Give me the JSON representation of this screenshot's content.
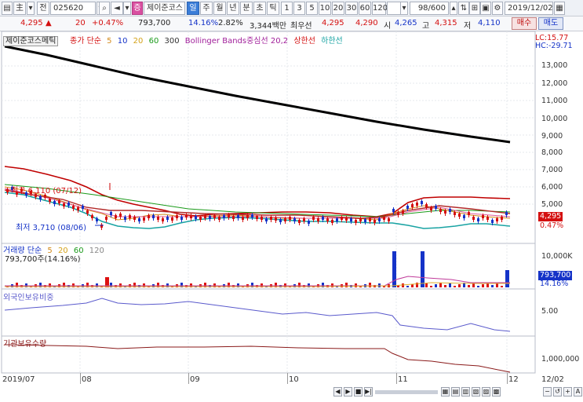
{
  "toolbar": {
    "code": "025620",
    "market_badge": "증",
    "stock_name": "제이준코스",
    "period_tabs": [
      "일",
      "주",
      "월",
      "년",
      "분",
      "초",
      "틱"
    ],
    "minute_options": [
      "1",
      "3",
      "5",
      "10",
      "20",
      "30",
      "60",
      "120"
    ],
    "count": "98/600",
    "date": "2019/12/02",
    "left_icons": [
      "chart-icon",
      "add-icon",
      "search-icon",
      "sound-icon"
    ],
    "right_icons": [
      "sort-icon",
      "link-icon",
      "save-icon",
      "settings-icon"
    ]
  },
  "quote": {
    "price": "4,295",
    "change_arrow": "▲",
    "change": "20",
    "change_pct": "+0.47%",
    "volume": "793,700",
    "turnover_pct": "14.16%",
    "rate": "2.82%",
    "amount": "3,344백만",
    "best_ask_label": "최우선",
    "best_ask": "4,295",
    "best_bid": "4,290",
    "open_label": "시",
    "open": "4,265",
    "high_label": "고",
    "high": "4,315",
    "low_label": "저",
    "low": "4,110",
    "buy_label": "매수",
    "sell_label": "매도"
  },
  "chart": {
    "index_legend": "제이준코스메틱",
    "price_legend": {
      "prefix": "종가 단순",
      "ma": [
        "5",
        "10",
        "20",
        "60",
        "300"
      ],
      "bb": "Bollinger Bands중심선 20,2",
      "upper": "상한선",
      "lower": "하한선"
    },
    "lc": "LC:15.77",
    "hc": "HC:-29.71",
    "price_axis": [
      "13,000",
      "12,000",
      "11,000",
      "10,000",
      "9,000",
      "8,000",
      "7,000",
      "6,000",
      "5,000"
    ],
    "price_tag": "4,295",
    "pct_tag": "0.47%",
    "high_note": "최고 6,110 (07/12)",
    "low_note": "최저 3,710 (08/06)",
    "volume_legend": {
      "prefix": "거래량 단순",
      "ma": [
        "5",
        "20",
        "60",
        "120"
      ],
      "current": "793,700주(14.16%)"
    },
    "volume_axis": "10,000K",
    "volume_tag": "793,700",
    "volume_pct_tag": "14.16%",
    "foreign_legend": "외국인보유비중",
    "foreign_axis": "5.00",
    "inst_legend": "기관보유수량",
    "inst_axis": "1,000,000",
    "x_labels": [
      "2019/07",
      "08",
      "09",
      "10",
      "11",
      "12"
    ],
    "date_box": "12/02",
    "scroll_icons": [
      "prev-icon",
      "next-icon",
      "stop-icon",
      "end-icon",
      "zoom-out-icon",
      "zoom-in-icon"
    ]
  },
  "colors": {
    "up": "#d41010",
    "down": "#1533c8",
    "index_line": "#000000",
    "bb_upper": "#c00000",
    "bb_lower": "#19a3a3",
    "ma5": "#d48a1a",
    "ma20": "#1a9a1a",
    "volume_bar": "#dd1111",
    "foreign_line": "#5a5acc",
    "inst_line": "#8a1a1a"
  }
}
